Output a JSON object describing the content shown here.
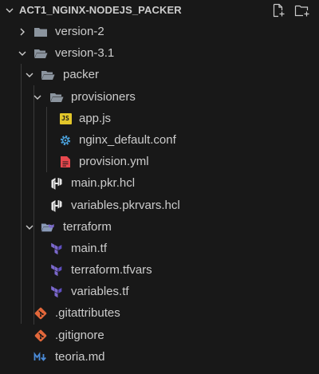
{
  "explorer": {
    "title": "ACT1_NGINX-NODEJS_PACKER",
    "actions": {
      "new_file": "New File...",
      "new_folder": "New Folder..."
    }
  },
  "tree": {
    "version_2": {
      "label": "version-2",
      "expanded": false
    },
    "version_3_1": {
      "label": "version-3.1",
      "expanded": true
    },
    "packer": {
      "label": "packer",
      "expanded": true
    },
    "provisioners": {
      "label": "provisioners",
      "expanded": true
    },
    "app_js": {
      "label": "app.js",
      "icon": "javascript-file-icon"
    },
    "nginx_conf": {
      "label": "nginx_default.conf",
      "icon": "gear-config-icon"
    },
    "provision_yml": {
      "label": "provision.yml",
      "icon": "yaml-file-icon"
    },
    "main_pkr": {
      "label": "main.pkr.hcl",
      "icon": "hashicorp-icon"
    },
    "variables_pkr": {
      "label": "variables.pkrvars.hcl",
      "icon": "hashicorp-icon"
    },
    "terraform": {
      "label": "terraform",
      "expanded": true
    },
    "main_tf": {
      "label": "main.tf",
      "icon": "terraform-icon"
    },
    "terraform_tfvars": {
      "label": "terraform.tfvars",
      "icon": "terraform-icon"
    },
    "variables_tf": {
      "label": "variables.tf",
      "icon": "terraform-icon"
    },
    "gitattributes": {
      "label": ".gitattributes",
      "icon": "git-icon"
    },
    "gitignore": {
      "label": ".gitignore",
      "icon": "git-icon"
    },
    "teoria_md": {
      "label": "teoria.md",
      "icon": "markdown-icon"
    }
  },
  "colors": {
    "background": "#181818",
    "text": "#cccccc",
    "folder": "#8b949e",
    "javascript": "#e2c62a",
    "config": "#4a9fd8",
    "yaml": "#e8484e",
    "terraform": "#7b68cc",
    "git": "#e2673a",
    "markdown": "#4a8ad6"
  }
}
